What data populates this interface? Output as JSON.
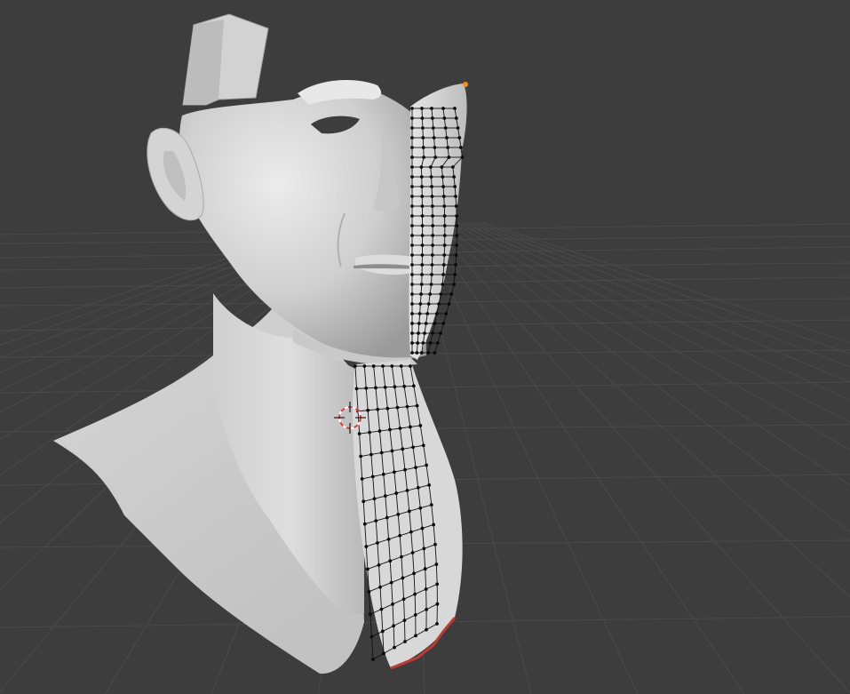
{
  "viewport": {
    "mode": "edit-mode-mesh",
    "background_color": "#3d3d3d",
    "grid_color": "#4a4a4a",
    "mesh_shade_light": "#e3e3e3",
    "mesh_shade_mid": "#bcbcbc",
    "mesh_shade_dark": "#8d8d8d",
    "wire_color": "#111111",
    "vertex_color": "#0b0b0b",
    "active_vertex_color": "#ff8a1a",
    "selected_edge_color": "#c03a34",
    "cursor_icon": "3d-cursor-icon"
  },
  "objects": [
    {
      "name_semantic": "sculpted-head-bust",
      "shading": "solid"
    },
    {
      "name_semantic": "retopology-mesh",
      "shading": "wireframe-overlay"
    }
  ]
}
